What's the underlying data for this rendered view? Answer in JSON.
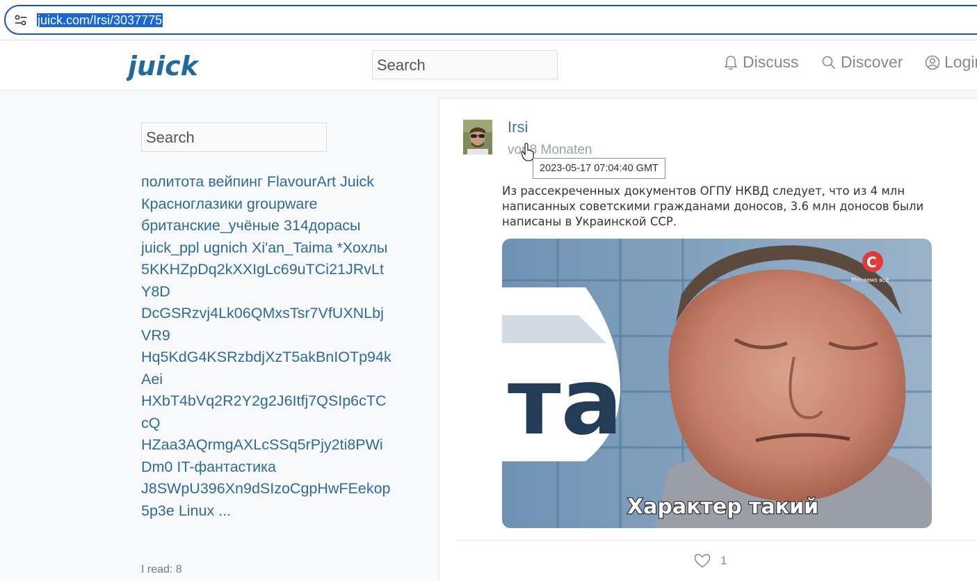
{
  "browser": {
    "url": "juick.com/Irsi/3037775",
    "site_info_icon": "tune-icon"
  },
  "header": {
    "logo_text": "juick",
    "search_placeholder": "Search",
    "nav": {
      "discuss": "Discuss",
      "discover": "Discover",
      "login": "Login"
    }
  },
  "sidebar": {
    "search_placeholder": "Search",
    "tags": [
      "политота",
      "вейпинг",
      "FlavourArt",
      "Juick",
      "Красноглазики",
      "groupware",
      "британские_учёные",
      "314дорасы",
      "juick_ppl",
      "ugnich",
      "Xi'an_Taima",
      "*Хохлы",
      "5KKHZpDq2kXXIgLc69uTCi21JRvLtY8D",
      "DcGSRzvj4Lk06QMxsTsr7VfUXNLbjVR9",
      "Hq5KdG4KSRzbdjXzT5akBnIOTp94kAei",
      "HXbT4bVq2R2Y2g2J6Itfj7QSIp6cTCcQ",
      "HZaa3AQrmgAXLcSSq5rPjy2ti8PWiDm0",
      "IT-фантастика",
      "J8SWpU396Xn9dSIzoCgpHwFEekop5p3e",
      "Linux",
      "..."
    ],
    "i_read": "I read: 8"
  },
  "post": {
    "author": "Irsi",
    "time_ago": "vor 8 Monaten",
    "tooltip": "2023-05-17 07:04:40 GMT",
    "text": "Из рассекреченных документов ОГПУ НКВД  следует, что из 4 млн написанных советскими гражданами доносов, 3.6 млн доносов были написаны в Украинской ССР.",
    "image_caption": "Характер такий",
    "image_channel": "Меняемо всё",
    "likes": "1"
  },
  "colors": {
    "accent": "#2e6b99",
    "logo": "#1e6c9c",
    "nav": "#7d8a97",
    "url_selection": "#1967d2"
  }
}
